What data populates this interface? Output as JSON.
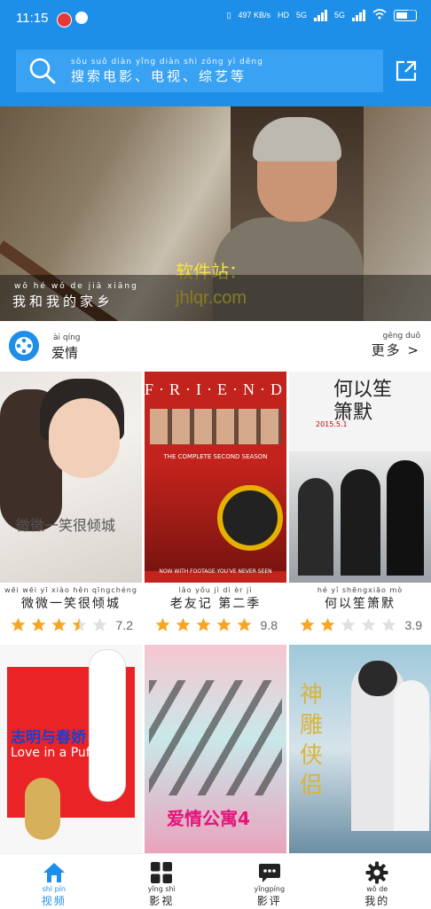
{
  "status_bar": {
    "time": "11:15",
    "net_speed": "497 KB/s",
    "hd": "HD",
    "sig1": "5G",
    "sig2": "5G",
    "battery": "87"
  },
  "search": {
    "placeholder_pinyin": "sōu suǒ diàn yǐng   diàn shì   zōng yì děng",
    "placeholder": "搜索电影、电视、综艺等"
  },
  "banner": {
    "watermark_line1": "软件站：",
    "watermark_line2": "jhlqr.com",
    "title_pinyin": "wǒ hé wǒ de jiā xiāng",
    "title": "我和我的家乡"
  },
  "section": {
    "title_pinyin": "ài qíng",
    "title": "爱情",
    "more_pinyin": "gēng duō",
    "more": "更多 >"
  },
  "movies": [
    {
      "title_pinyin": "wēi wēi  yī xiào hěn qīngchéng",
      "title": "微微一笑很倾城",
      "score": "7.2",
      "stars": 3.5
    },
    {
      "title_pinyin": "lǎo yǒu jì   dì  èr   jì",
      "title": "老友记 第二季",
      "score": "9.8",
      "stars": 5
    },
    {
      "title_pinyin": "hé  yǐ shēngxiāo mò",
      "title": "何以笙箫默",
      "score": "3.9",
      "stars": 2
    }
  ],
  "posters": {
    "p1_title": "微微一笑很倾城",
    "p2_title": "F·R·I·E·N·D·S",
    "p2_sub": "THE COMPLETE SECOND SEASON",
    "p2_bottom": "NOW WITH FOOTAGE YOU'VE NEVER SEEN",
    "p3_title": "何以笙箫默",
    "p3_date": "2015.5.1",
    "p4_title": "志明与春娇",
    "p4_sub": "Love in a Puff",
    "p5_title": "爱情公寓4",
    "p6_title": "神雕侠侣"
  },
  "nav": [
    {
      "pinyin": "shì pín",
      "label": "视频",
      "icon": "home-icon",
      "active": true
    },
    {
      "pinyin": "yǐng shì",
      "label": "影视",
      "icon": "grid-icon",
      "active": false
    },
    {
      "pinyin": "yǐngpíng",
      "label": "影评",
      "icon": "chat-icon",
      "active": false
    },
    {
      "pinyin": "wǒ de",
      "label": "我的",
      "icon": "gear-icon",
      "active": false
    }
  ],
  "colors": {
    "primary": "#1e8fe8",
    "star": "#f6a623",
    "star_empty": "#e0e0e0"
  }
}
